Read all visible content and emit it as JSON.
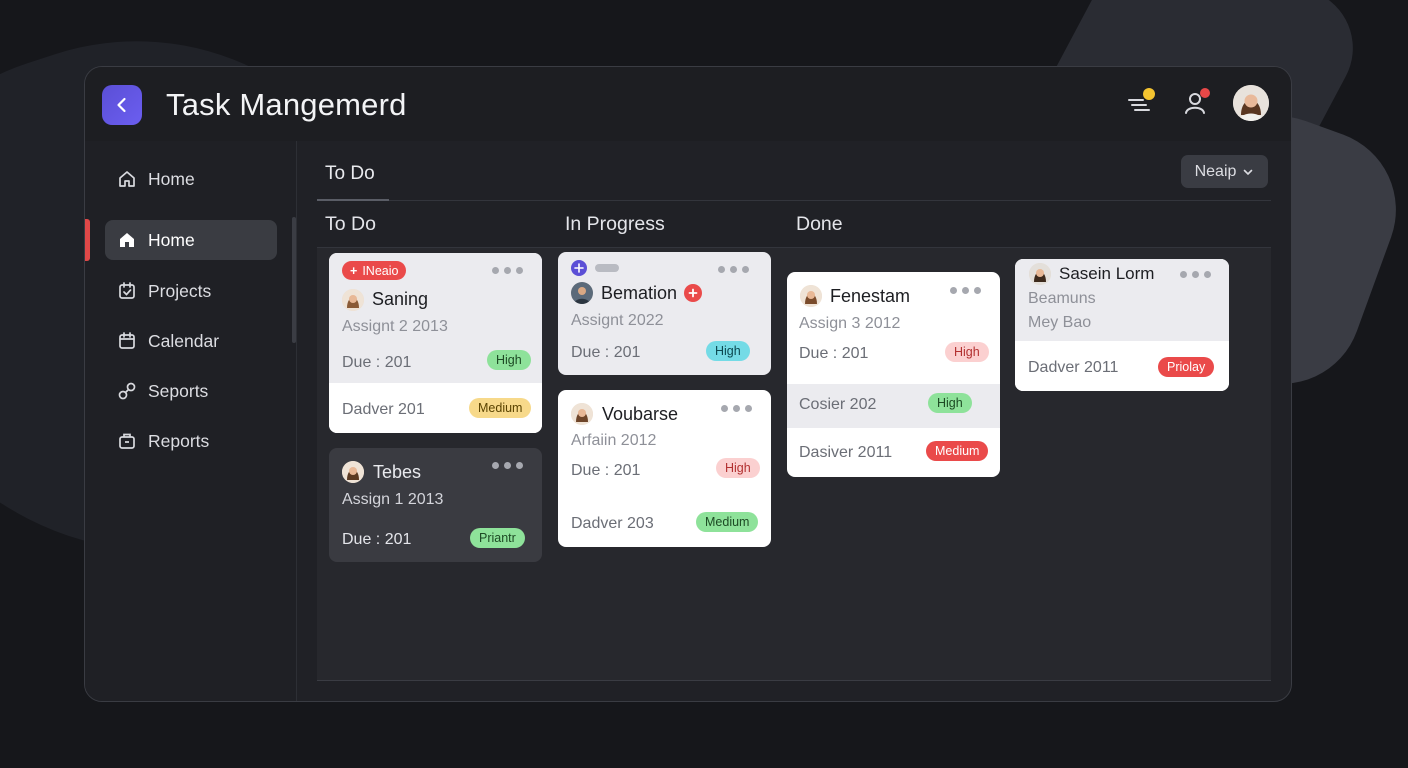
{
  "app": {
    "title": "Task Mangemerd"
  },
  "sidebar": {
    "items": [
      {
        "label": "Home",
        "icon": "home-outline-icon"
      },
      {
        "label": "Home",
        "icon": "home-filled-icon",
        "active": true
      },
      {
        "label": "Projects",
        "icon": "calendar-check-icon"
      },
      {
        "label": "Calendar",
        "icon": "calendar-icon"
      },
      {
        "label": "Seports",
        "icon": "link-icon"
      },
      {
        "label": "Reports",
        "icon": "briefcase-icon"
      }
    ]
  },
  "main": {
    "tab": "To Do",
    "filter": {
      "label": "Neaip"
    },
    "columns": [
      "To Do",
      "In Progress",
      "Done"
    ]
  },
  "cards": {
    "todo1": {
      "tag": "INeaio",
      "name": "Saning",
      "assign": "Assignt 2 2013",
      "due": "Due : 201",
      "due_badge": "High",
      "footer": "Dadver 201",
      "footer_badge": "Medium"
    },
    "todo2": {
      "name": "Tebes",
      "assign": "Assign 1 2013",
      "due": "Due : 201",
      "due_badge": "Priantr"
    },
    "prog1": {
      "name": "Bemation",
      "assign": "Assignt 2022",
      "due": "Due : 201",
      "due_badge": "High"
    },
    "prog2": {
      "name": "Voubarse",
      "assign": "Arfaiin 2012",
      "due": "Due : 201",
      "due_badge": "High",
      "footer": "Dadver 203",
      "footer_badge": "Medium"
    },
    "done1": {
      "name": "Fenestam",
      "assign": "Assign 3 2012",
      "due": "Due : 201",
      "due_badge": "High",
      "row2": "Cosier 202",
      "row2_badge": "High",
      "footer": "Dasiver 2011",
      "footer_badge": "Medium"
    },
    "done2": {
      "name": "Sasein Lorm",
      "line1": "Beamuns",
      "line2": "Mey Bao",
      "footer": "Dadver 2011",
      "footer_badge": "Priolay"
    }
  },
  "colors": {
    "accent": "#5b4fd6",
    "active_marker": "#e04848",
    "badge_green": "#8ee29a",
    "badge_red": "#ea4a4a",
    "badge_teal": "#74dbe6",
    "badge_yellow": "#f7d98a"
  }
}
